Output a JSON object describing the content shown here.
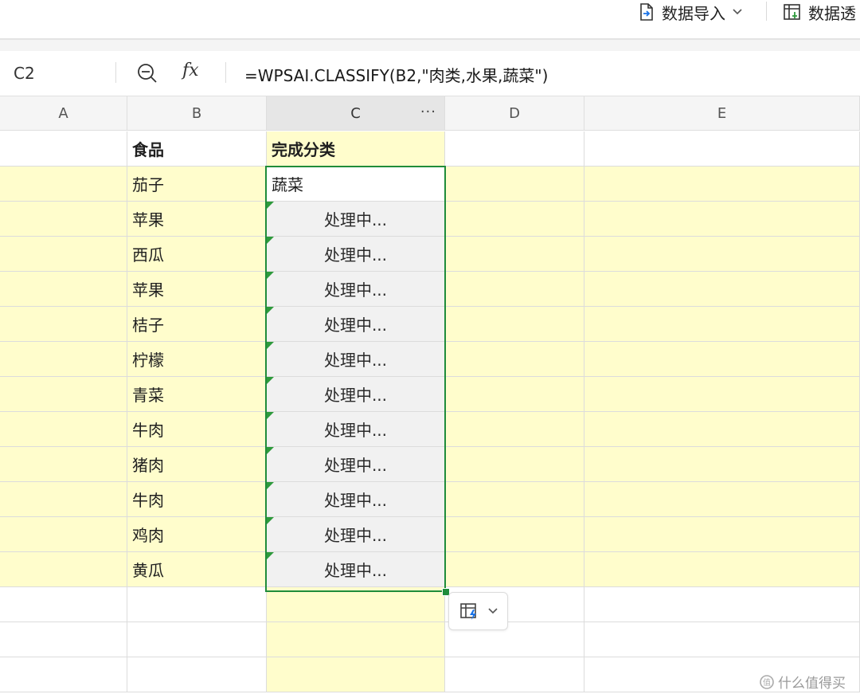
{
  "toolbar": {
    "import_label": "数据导入",
    "pivot_label": "数据透"
  },
  "formula_bar": {
    "cell_ref": "C2",
    "fx_label": "fx",
    "formula": "=WPSAI.CLASSIFY(B2,\"肉类,水果,蔬菜\")"
  },
  "columns": [
    "A",
    "B",
    "C",
    "D",
    "E"
  ],
  "column_c_more": "···",
  "header_row": {
    "b": "食品",
    "c": "完成分类"
  },
  "rows": [
    {
      "food": "茄子",
      "result": "蔬菜"
    },
    {
      "food": "苹果",
      "result": "处理中..."
    },
    {
      "food": "西瓜",
      "result": "处理中..."
    },
    {
      "food": "苹果",
      "result": "处理中..."
    },
    {
      "food": "桔子",
      "result": "处理中..."
    },
    {
      "food": "柠檬",
      "result": "处理中..."
    },
    {
      "food": "青菜",
      "result": "处理中..."
    },
    {
      "food": "牛肉",
      "result": "处理中..."
    },
    {
      "food": "猪肉",
      "result": "处理中..."
    },
    {
      "food": "牛肉",
      "result": "处理中..."
    },
    {
      "food": "鸡肉",
      "result": "处理中..."
    },
    {
      "food": "黄瓜",
      "result": "处理中..."
    }
  ],
  "watermark": "什么值得买",
  "colors": {
    "row_highlight": "#fffdcc",
    "selection": "#1f8c3a",
    "processing_bg": "#f1f1f1"
  }
}
